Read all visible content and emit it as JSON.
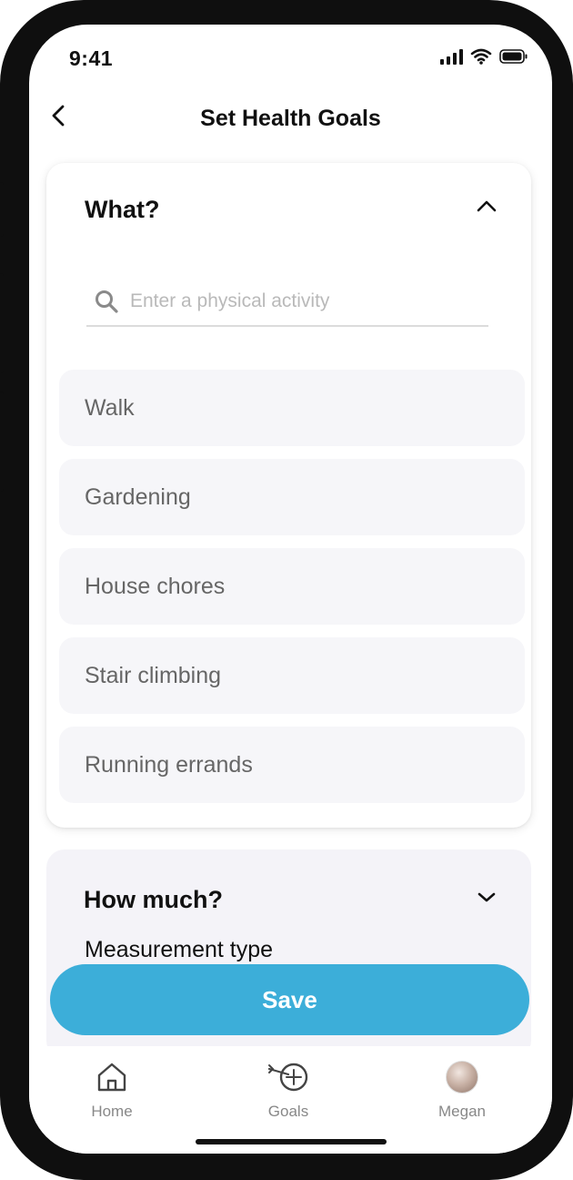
{
  "status_bar": {
    "time": "9:41"
  },
  "header": {
    "title": "Set Health Goals"
  },
  "what_section": {
    "title": "What?",
    "search_placeholder": "Enter a physical activity",
    "activities": [
      "Walk",
      "Gardening",
      "House chores",
      "Stair climbing",
      "Running errands"
    ]
  },
  "how_much_section": {
    "title": "How much?",
    "measurement_label": "Measurement type"
  },
  "save_label": "Save",
  "nav": {
    "home": "Home",
    "goals": "Goals",
    "profile": "Megan"
  },
  "colors": {
    "accent": "#3caed9",
    "card_bg": "#f4f3f8",
    "item_bg": "#f6f6f9"
  },
  "icons": [
    "back-chevron-icon",
    "chevron-up-icon",
    "chevron-down-icon",
    "search-icon",
    "home-icon",
    "goals-target-icon",
    "signal-icon",
    "wifi-icon",
    "battery-icon"
  ]
}
